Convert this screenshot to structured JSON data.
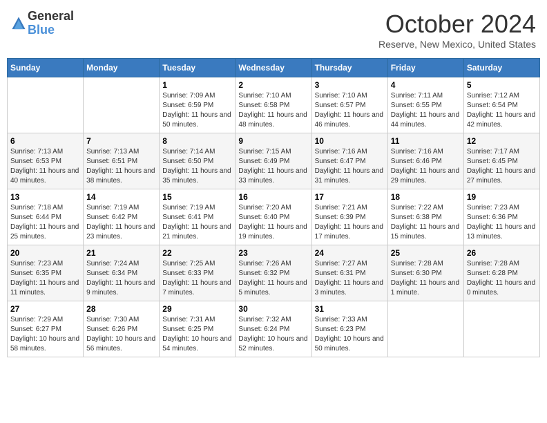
{
  "header": {
    "logo_general": "General",
    "logo_blue": "Blue",
    "month": "October 2024",
    "location": "Reserve, New Mexico, United States"
  },
  "weekdays": [
    "Sunday",
    "Monday",
    "Tuesday",
    "Wednesday",
    "Thursday",
    "Friday",
    "Saturday"
  ],
  "weeks": [
    [
      null,
      null,
      {
        "day": 1,
        "sunrise": "7:09 AM",
        "sunset": "6:59 PM",
        "daylight": "11 hours and 50 minutes."
      },
      {
        "day": 2,
        "sunrise": "7:10 AM",
        "sunset": "6:58 PM",
        "daylight": "11 hours and 48 minutes."
      },
      {
        "day": 3,
        "sunrise": "7:10 AM",
        "sunset": "6:57 PM",
        "daylight": "11 hours and 46 minutes."
      },
      {
        "day": 4,
        "sunrise": "7:11 AM",
        "sunset": "6:55 PM",
        "daylight": "11 hours and 44 minutes."
      },
      {
        "day": 5,
        "sunrise": "7:12 AM",
        "sunset": "6:54 PM",
        "daylight": "11 hours and 42 minutes."
      }
    ],
    [
      {
        "day": 6,
        "sunrise": "7:13 AM",
        "sunset": "6:53 PM",
        "daylight": "11 hours and 40 minutes."
      },
      {
        "day": 7,
        "sunrise": "7:13 AM",
        "sunset": "6:51 PM",
        "daylight": "11 hours and 38 minutes."
      },
      {
        "day": 8,
        "sunrise": "7:14 AM",
        "sunset": "6:50 PM",
        "daylight": "11 hours and 35 minutes."
      },
      {
        "day": 9,
        "sunrise": "7:15 AM",
        "sunset": "6:49 PM",
        "daylight": "11 hours and 33 minutes."
      },
      {
        "day": 10,
        "sunrise": "7:16 AM",
        "sunset": "6:47 PM",
        "daylight": "11 hours and 31 minutes."
      },
      {
        "day": 11,
        "sunrise": "7:16 AM",
        "sunset": "6:46 PM",
        "daylight": "11 hours and 29 minutes."
      },
      {
        "day": 12,
        "sunrise": "7:17 AM",
        "sunset": "6:45 PM",
        "daylight": "11 hours and 27 minutes."
      }
    ],
    [
      {
        "day": 13,
        "sunrise": "7:18 AM",
        "sunset": "6:44 PM",
        "daylight": "11 hours and 25 minutes."
      },
      {
        "day": 14,
        "sunrise": "7:19 AM",
        "sunset": "6:42 PM",
        "daylight": "11 hours and 23 minutes."
      },
      {
        "day": 15,
        "sunrise": "7:19 AM",
        "sunset": "6:41 PM",
        "daylight": "11 hours and 21 minutes."
      },
      {
        "day": 16,
        "sunrise": "7:20 AM",
        "sunset": "6:40 PM",
        "daylight": "11 hours and 19 minutes."
      },
      {
        "day": 17,
        "sunrise": "7:21 AM",
        "sunset": "6:39 PM",
        "daylight": "11 hours and 17 minutes."
      },
      {
        "day": 18,
        "sunrise": "7:22 AM",
        "sunset": "6:38 PM",
        "daylight": "11 hours and 15 minutes."
      },
      {
        "day": 19,
        "sunrise": "7:23 AM",
        "sunset": "6:36 PM",
        "daylight": "11 hours and 13 minutes."
      }
    ],
    [
      {
        "day": 20,
        "sunrise": "7:23 AM",
        "sunset": "6:35 PM",
        "daylight": "11 hours and 11 minutes."
      },
      {
        "day": 21,
        "sunrise": "7:24 AM",
        "sunset": "6:34 PM",
        "daylight": "11 hours and 9 minutes."
      },
      {
        "day": 22,
        "sunrise": "7:25 AM",
        "sunset": "6:33 PM",
        "daylight": "11 hours and 7 minutes."
      },
      {
        "day": 23,
        "sunrise": "7:26 AM",
        "sunset": "6:32 PM",
        "daylight": "11 hours and 5 minutes."
      },
      {
        "day": 24,
        "sunrise": "7:27 AM",
        "sunset": "6:31 PM",
        "daylight": "11 hours and 3 minutes."
      },
      {
        "day": 25,
        "sunrise": "7:28 AM",
        "sunset": "6:30 PM",
        "daylight": "11 hours and 1 minute."
      },
      {
        "day": 26,
        "sunrise": "7:28 AM",
        "sunset": "6:28 PM",
        "daylight": "11 hours and 0 minutes."
      }
    ],
    [
      {
        "day": 27,
        "sunrise": "7:29 AM",
        "sunset": "6:27 PM",
        "daylight": "10 hours and 58 minutes."
      },
      {
        "day": 28,
        "sunrise": "7:30 AM",
        "sunset": "6:26 PM",
        "daylight": "10 hours and 56 minutes."
      },
      {
        "day": 29,
        "sunrise": "7:31 AM",
        "sunset": "6:25 PM",
        "daylight": "10 hours and 54 minutes."
      },
      {
        "day": 30,
        "sunrise": "7:32 AM",
        "sunset": "6:24 PM",
        "daylight": "10 hours and 52 minutes."
      },
      {
        "day": 31,
        "sunrise": "7:33 AM",
        "sunset": "6:23 PM",
        "daylight": "10 hours and 50 minutes."
      },
      null,
      null
    ]
  ]
}
